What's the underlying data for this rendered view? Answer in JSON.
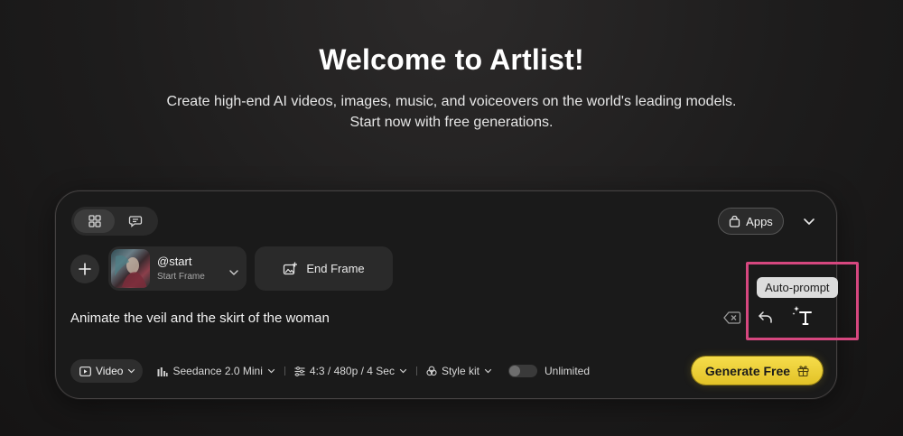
{
  "hero": {
    "title": "Welcome to Artlist!",
    "subtitle_line1": "Create high-end AI videos, images, music, and voiceovers on the world's leading models.",
    "subtitle_line2": "Start now with free generations."
  },
  "header": {
    "apps_label": "Apps"
  },
  "frames": {
    "start_label": "@start",
    "start_sub": "Start Frame",
    "end_label": "End Frame"
  },
  "prompt": {
    "text": "Animate the veil and the skirt of the woman"
  },
  "toolbar": {
    "video_label": "Video",
    "model_label": "Seedance 2.0 Mini",
    "settings_label": "4:3 / 480p / 4 Sec",
    "style_label": "Style kit",
    "unlimited_label": "Unlimited",
    "unlimited_on": false
  },
  "generate": {
    "label": "Generate Free"
  },
  "tooltip": {
    "text": "Auto-prompt"
  },
  "colors": {
    "accent_yellow": "#f0d43a",
    "highlight_pink": "#d6477f"
  }
}
